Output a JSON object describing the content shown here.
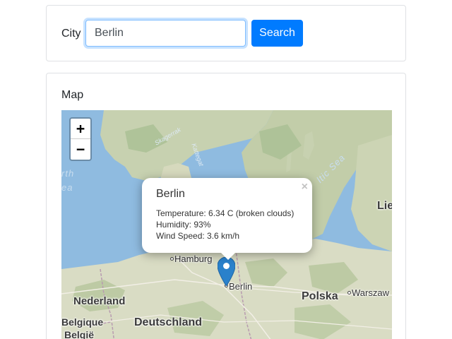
{
  "search": {
    "label": "City",
    "value": "Berlin",
    "button_label": "Search"
  },
  "map_card": {
    "title": "Map"
  },
  "map": {
    "zoom_in": "+",
    "zoom_out": "−",
    "popup": {
      "title": "Berlin",
      "close": "×",
      "temperature": "Temperature: 6.34 C (broken clouds)",
      "humidity": "Humidity: 93%",
      "wind_speed": "Wind Speed: 3.6 km/h"
    },
    "labels": {
      "hamburg": "Hamburg",
      "berlin": "Berlin",
      "polska": "Polska",
      "warszawa": "Warszaw",
      "nederland": "Nederland",
      "deutschland": "Deutschland",
      "belgique": "Belgique",
      "belgie": "België",
      "lie": "Lie",
      "skagerrak": "Skagerrak",
      "kattegat": "Kattegat",
      "baltic_sea": "ltic Sea",
      "north_sea_1": "rth",
      "north_sea_2": "ea"
    },
    "colors": {
      "water": "#8fbbe0",
      "land": "#d9dcc4",
      "forest": "#a9bf93",
      "marker": "#2a81cb",
      "button": "#007bff"
    }
  }
}
